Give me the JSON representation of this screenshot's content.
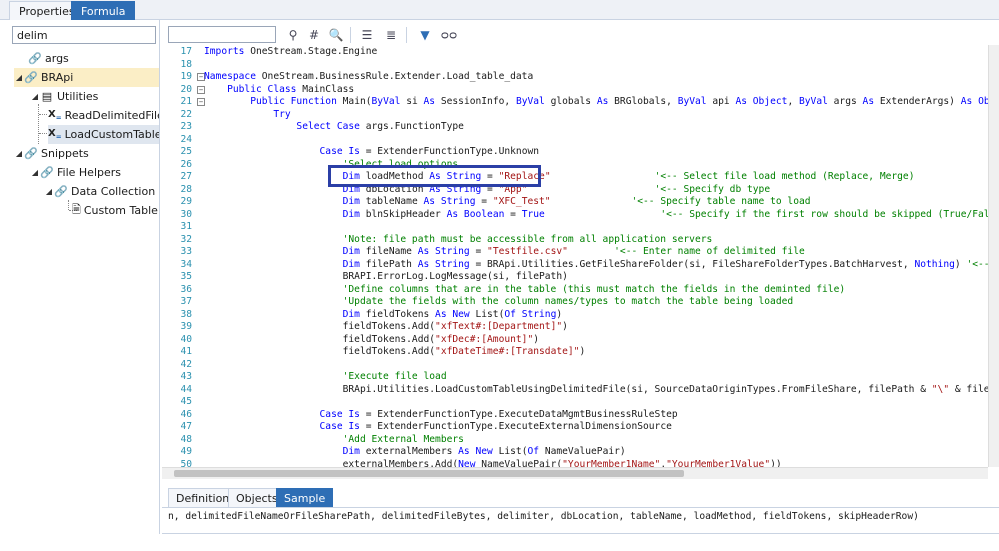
{
  "top_tabs": [
    "Properties",
    "Formula"
  ],
  "search": {
    "value": "delim"
  },
  "tree": [
    {
      "label": "args",
      "icon": "assembly-icon"
    },
    {
      "label": "BRApi",
      "icon": "assembly-icon"
    },
    {
      "label": "Utilities",
      "icon": "class-icon"
    },
    {
      "label": "ReadDelimitedFileTa",
      "icon": "method-icon"
    },
    {
      "label": "LoadCustomTableU",
      "icon": "method-icon"
    },
    {
      "label": "Snippets",
      "icon": "assembly-icon"
    },
    {
      "label": "File Helpers",
      "icon": "assembly-icon"
    },
    {
      "label": "Data Collection",
      "icon": "assembly-icon"
    },
    {
      "label": "Custom Table Lo",
      "icon": "document-icon"
    }
  ],
  "toolbar": {
    "icons": [
      "binoculars-icon",
      "hash-icon",
      "find-replace-icon",
      "comment-icon",
      "uncomment-icon",
      "filter-icon",
      "glasses-icon"
    ],
    "glyph_hash": "#"
  },
  "code": [
    {
      "n": "17",
      "segs": [
        [
          "k",
          "Imports "
        ],
        [
          "t",
          "OneStream.Stage.Engine"
        ]
      ]
    },
    {
      "n": "18",
      "segs": []
    },
    {
      "n": "19",
      "fold": "−",
      "segs": [
        [
          "k",
          "Namespace "
        ],
        [
          "t",
          "OneStream.BusinessRule.Extender.Load_table_data"
        ]
      ]
    },
    {
      "n": "20",
      "fold": "−",
      "segs": [
        [
          "t",
          "    "
        ],
        [
          "k",
          "Public Class "
        ],
        [
          "t",
          "MainClass"
        ]
      ]
    },
    {
      "n": "21",
      "fold": "−",
      "segs": [
        [
          "t",
          "        "
        ],
        [
          "k",
          "Public Function "
        ],
        [
          "t",
          "Main("
        ],
        [
          "k",
          "ByVal "
        ],
        [
          "t",
          "si "
        ],
        [
          "k",
          "As "
        ],
        [
          "t",
          "SessionInfo, "
        ],
        [
          "k",
          "ByVal "
        ],
        [
          "t",
          "globals "
        ],
        [
          "k",
          "As "
        ],
        [
          "t",
          "BRGlobals, "
        ],
        [
          "k",
          "ByVal "
        ],
        [
          "t",
          "api "
        ],
        [
          "k",
          "As Object"
        ],
        [
          "t",
          ", "
        ],
        [
          "k",
          "ByVal "
        ],
        [
          "t",
          "args "
        ],
        [
          "k",
          "As "
        ],
        [
          "t",
          "ExtenderArgs) "
        ],
        [
          "k",
          "As Object"
        ]
      ]
    },
    {
      "n": "22",
      "segs": [
        [
          "t",
          "            "
        ],
        [
          "k",
          "Try"
        ]
      ]
    },
    {
      "n": "23",
      "segs": [
        [
          "t",
          "                "
        ],
        [
          "k",
          "Select Case "
        ],
        [
          "t",
          "args.FunctionType"
        ]
      ]
    },
    {
      "n": "24",
      "segs": []
    },
    {
      "n": "25",
      "segs": [
        [
          "t",
          "                    "
        ],
        [
          "k",
          "Case Is "
        ],
        [
          "t",
          "= ExtenderFunctionType.Unknown"
        ]
      ]
    },
    {
      "n": "26",
      "segs": [
        [
          "t",
          "                        "
        ],
        [
          "c",
          "'Select load options"
        ]
      ]
    },
    {
      "n": "27",
      "segs": [
        [
          "t",
          "                        "
        ],
        [
          "k",
          "Dim "
        ],
        [
          "t",
          "loadMethod "
        ],
        [
          "k",
          "As String "
        ],
        [
          "t",
          "= "
        ],
        [
          "s",
          "\"Replace\""
        ],
        [
          "t",
          "                  "
        ],
        [
          "c",
          "'<-- Select file load method (Replace, Merge)"
        ]
      ]
    },
    {
      "n": "28",
      "segs": [
        [
          "t",
          "                        "
        ],
        [
          "k",
          "Dim "
        ],
        [
          "t",
          "dbLocation "
        ],
        [
          "k",
          "As String "
        ],
        [
          "t",
          "= "
        ],
        [
          "s",
          "\"App\""
        ],
        [
          "t",
          "                      "
        ],
        [
          "c",
          "'<-- Specify db type"
        ]
      ]
    },
    {
      "n": "29",
      "segs": [
        [
          "t",
          "                        "
        ],
        [
          "k",
          "Dim "
        ],
        [
          "t",
          "tableName "
        ],
        [
          "k",
          "As String "
        ],
        [
          "t",
          "= "
        ],
        [
          "s",
          "\"XFC_Test\""
        ],
        [
          "t",
          "              "
        ],
        [
          "c",
          "'<-- Specify table name to load"
        ]
      ]
    },
    {
      "n": "30",
      "segs": [
        [
          "t",
          "                        "
        ],
        [
          "k",
          "Dim "
        ],
        [
          "t",
          "blnSkipHeader "
        ],
        [
          "k",
          "As Boolean "
        ],
        [
          "t",
          "= "
        ],
        [
          "k",
          "True"
        ],
        [
          "t",
          "                    "
        ],
        [
          "c",
          "'<-- Specify if the first row should be skipped (True/False)"
        ]
      ]
    },
    {
      "n": "31",
      "segs": []
    },
    {
      "n": "32",
      "segs": [
        [
          "t",
          "                        "
        ],
        [
          "c",
          "'Note: file path must be accessible from all application servers"
        ]
      ]
    },
    {
      "n": "33",
      "segs": [
        [
          "t",
          "                        "
        ],
        [
          "k",
          "Dim "
        ],
        [
          "t",
          "fileName "
        ],
        [
          "k",
          "As String "
        ],
        [
          "t",
          "= "
        ],
        [
          "s",
          "\"Testfile.csv\""
        ],
        [
          "t",
          "        "
        ],
        [
          "c",
          "'<-- Enter name of delimited file"
        ]
      ]
    },
    {
      "n": "34",
      "segs": [
        [
          "t",
          "                        "
        ],
        [
          "k",
          "Dim "
        ],
        [
          "t",
          "filePath "
        ],
        [
          "k",
          "As String "
        ],
        [
          "t",
          "= BRApi.Utilities.GetFileShareFolder(si, FileShareFolderTypes.BatchHarvest, "
        ],
        [
          "k",
          "Nothing"
        ],
        [
          "t",
          ") "
        ],
        [
          "c",
          "'<-- Enter pa"
        ]
      ]
    },
    {
      "n": "35",
      "segs": [
        [
          "t",
          "                        "
        ],
        [
          "t",
          "BRAPI.ErrorLog.LogMessage(si, filePath)"
        ]
      ]
    },
    {
      "n": "36",
      "segs": [
        [
          "t",
          "                        "
        ],
        [
          "c",
          "'Define columns that are in the table (this must match the fields in the deminted file)"
        ]
      ]
    },
    {
      "n": "37",
      "segs": [
        [
          "t",
          "                        "
        ],
        [
          "c",
          "'Update the fields with the column names/types to match the table being loaded"
        ]
      ]
    },
    {
      "n": "38",
      "segs": [
        [
          "t",
          "                        "
        ],
        [
          "k",
          "Dim "
        ],
        [
          "t",
          "fieldTokens "
        ],
        [
          "k",
          "As New "
        ],
        [
          "t",
          "List("
        ],
        [
          "k",
          "Of String"
        ],
        [
          "t",
          ")"
        ]
      ]
    },
    {
      "n": "39",
      "segs": [
        [
          "t",
          "                        "
        ],
        [
          "t",
          "fieldTokens.Add("
        ],
        [
          "s",
          "\"xfText#:[Department]\""
        ],
        [
          "t",
          ")"
        ]
      ]
    },
    {
      "n": "40",
      "segs": [
        [
          "t",
          "                        "
        ],
        [
          "t",
          "fieldTokens.Add("
        ],
        [
          "s",
          "\"xfDec#:[Amount]\""
        ],
        [
          "t",
          ")"
        ]
      ]
    },
    {
      "n": "41",
      "segs": [
        [
          "t",
          "                        "
        ],
        [
          "t",
          "fieldTokens.Add("
        ],
        [
          "s",
          "\"xfDateTime#:[Transdate]\""
        ],
        [
          "t",
          ")"
        ]
      ]
    },
    {
      "n": "42",
      "segs": []
    },
    {
      "n": "43",
      "segs": [
        [
          "t",
          "                        "
        ],
        [
          "c",
          "'Execute file load"
        ]
      ]
    },
    {
      "n": "44",
      "segs": [
        [
          "t",
          "                        "
        ],
        [
          "t",
          "BRApi.Utilities.LoadCustomTableUsingDelimitedFile(si, SourceDataOriginTypes.FromFileShare, filePath & "
        ],
        [
          "s",
          "\"\\\""
        ],
        [
          "t",
          " & fileName, "
        ],
        [
          "k",
          "Not"
        ]
      ]
    },
    {
      "n": "45",
      "segs": []
    },
    {
      "n": "46",
      "segs": [
        [
          "t",
          "                    "
        ],
        [
          "k",
          "Case Is "
        ],
        [
          "t",
          "= ExtenderFunctionType.ExecuteDataMgmtBusinessRuleStep"
        ]
      ]
    },
    {
      "n": "47",
      "segs": [
        [
          "t",
          "                    "
        ],
        [
          "k",
          "Case Is "
        ],
        [
          "t",
          "= ExtenderFunctionType.ExecuteExternalDimensionSource"
        ]
      ]
    },
    {
      "n": "48",
      "segs": [
        [
          "t",
          "                        "
        ],
        [
          "c",
          "'Add External Members"
        ]
      ]
    },
    {
      "n": "49",
      "segs": [
        [
          "t",
          "                        "
        ],
        [
          "k",
          "Dim "
        ],
        [
          "t",
          "externalMembers "
        ],
        [
          "k",
          "As New "
        ],
        [
          "t",
          "List("
        ],
        [
          "k",
          "Of "
        ],
        [
          "t",
          "NameValuePair)"
        ]
      ]
    },
    {
      "n": "50",
      "segs": [
        [
          "t",
          "                        "
        ],
        [
          "t",
          "externalMembers.Add("
        ],
        [
          "k",
          "New "
        ],
        [
          "t",
          "NameValuePair("
        ],
        [
          "s",
          "\"YourMember1Name\""
        ],
        [
          "t",
          ","
        ],
        [
          "s",
          "\"YourMember1Value\""
        ],
        [
          "t",
          "))"
        ]
      ]
    }
  ],
  "bottom_tabs": [
    "Definition",
    "Objects",
    "Sample"
  ],
  "sample_text": "n, delimitedFileNameOrFileSharePath, delimitedFileBytes, delimiter, dbLocation, tableName, loadMethod, fieldTokens, skipHeaderRow)"
}
